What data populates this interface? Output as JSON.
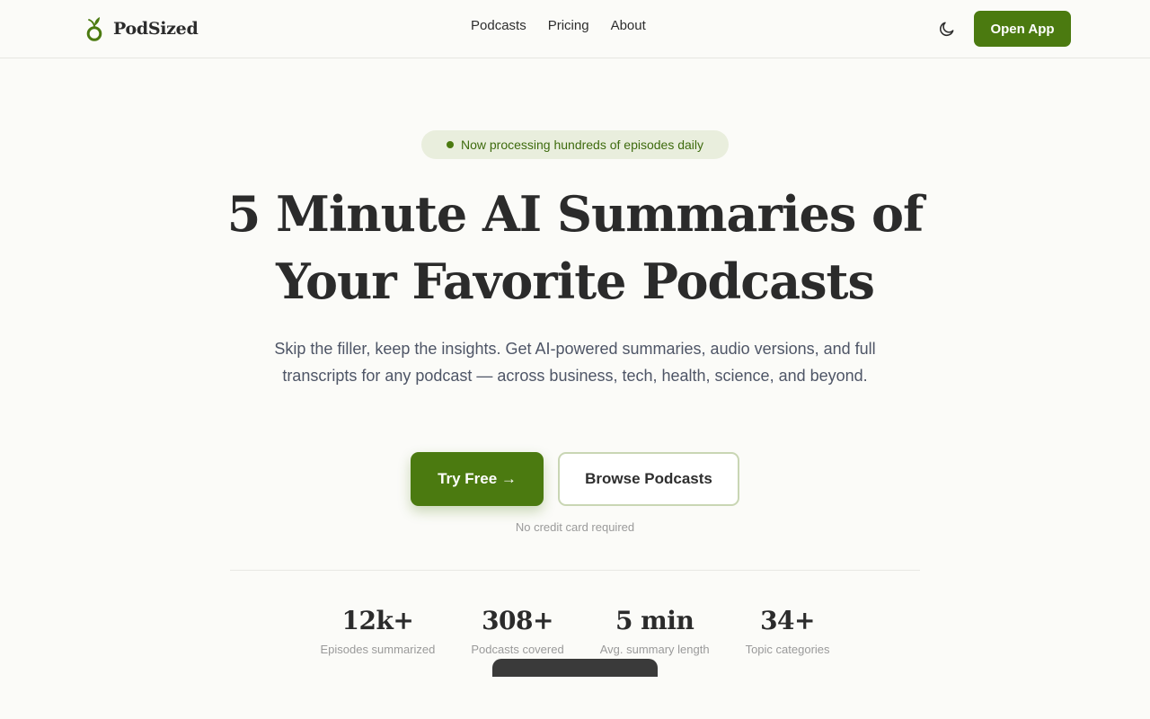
{
  "brand": {
    "name": "PodSized",
    "accent": "#4b7a10",
    "logo_icon": "acorn-sprout-icon"
  },
  "nav": {
    "links": [
      "Podcasts",
      "Pricing",
      "About"
    ],
    "theme_icon": "moon-icon",
    "open_app_label": "Open App"
  },
  "hero": {
    "badge_text": "Now processing hundreds of episodes daily",
    "headline_line1": "5 Minute AI Summaries of",
    "headline_line2": "Your Favorite Podcasts",
    "subtext": "Skip the filler, keep the insights. Get AI-powered summaries, audio versions, and full transcripts for any podcast — across business, tech, health, science, and beyond.",
    "primary_cta": "Try Free →",
    "secondary_cta": "Browse Podcasts",
    "cta_note": "No credit card required"
  },
  "stats": [
    {
      "value": "12k+",
      "label": "Episodes summarized"
    },
    {
      "value": "308+",
      "label": "Podcasts covered"
    },
    {
      "value": "5 min",
      "label": "Avg. summary length"
    },
    {
      "value": "34+",
      "label": "Topic categories"
    }
  ]
}
